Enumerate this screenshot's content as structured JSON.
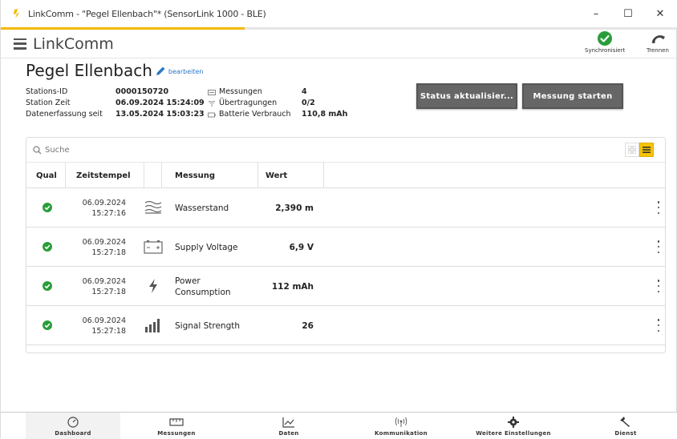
{
  "window": {
    "title": "LinkComm - \"Pegel Ellenbach\"* (SensorLink 1000 - BLE)",
    "minimize": "–",
    "maximize": "☐",
    "close": "✕",
    "progress_fraction": 0.36
  },
  "header": {
    "brand": "LinkComm",
    "sync_label": "Synchronisiert",
    "disconnect_label": "Trennen"
  },
  "station": {
    "name": "Pegel Ellenbach",
    "edit_label": "bearbeiten",
    "labels": [
      "Stations-ID",
      "Station Zeit",
      "Datenerfassung seit"
    ],
    "values": [
      "0000150720",
      "06.09.2024 15:24:09",
      "13.05.2024 15:03:23"
    ],
    "stat_labels": [
      "Messungen",
      "Übertragungen",
      "Batterie Verbrauch"
    ],
    "stat_values": [
      "4",
      "0/2",
      "110,8 mAh"
    ]
  },
  "actions": {
    "status_button": "Status aktualisier...",
    "measure_button": "Messung starten"
  },
  "table": {
    "search_placeholder": "Suche",
    "columns": [
      "Qual",
      "Zeitstempel",
      "Messung",
      "Wert"
    ],
    "rows": [
      {
        "date": "06.09.2024",
        "time": "15:27:16",
        "icon": "water-level-icon",
        "name": "Wasserstand",
        "value": "2,390 m"
      },
      {
        "date": "06.09.2024",
        "time": "15:27:18",
        "icon": "battery-icon",
        "name": "Supply Voltage",
        "value": "6,9 V"
      },
      {
        "date": "06.09.2024",
        "time": "15:27:18",
        "icon": "lightning-icon",
        "name": "Power Consumption",
        "value": "112 mAh"
      },
      {
        "date": "06.09.2024",
        "time": "15:27:18",
        "icon": "signal-strength-icon",
        "name": "Signal Strength",
        "value": "26"
      }
    ]
  },
  "nav": {
    "items": [
      "Dashboard",
      "Messungen",
      "Daten",
      "Kommunikation",
      "Weitere Einstellungen",
      "Dienst"
    ],
    "active": "Dashboard"
  },
  "colors": {
    "accent": "#f5c400",
    "success": "#2a9d3a",
    "button": "#666666",
    "link": "#2a78c5"
  }
}
